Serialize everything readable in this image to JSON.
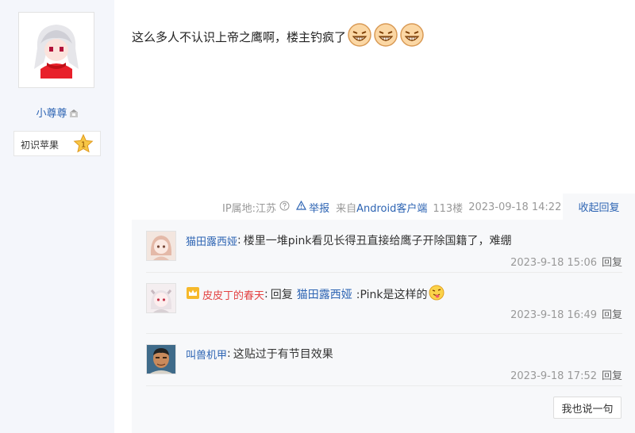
{
  "author": {
    "name": "小尊尊",
    "level_label": "初识苹果",
    "level_number": "1"
  },
  "post": {
    "text": "这么多人不认识上帝之鹰啊，楼主钓疯了"
  },
  "meta": {
    "ip_location": "IP属地:江苏",
    "report": "举报",
    "source_prefix": "来自",
    "source_app": "Android客户端",
    "floor": "113楼",
    "datetime": "2023-09-18 14:22",
    "collapse_reply": "收起回复"
  },
  "replies": [
    {
      "user": "猫田露西娅",
      "colon": ":",
      "text": "楼里一堆pink看见长得丑直接给鹰子开除国籍了，难绷",
      "time": "2023-9-18 15:06",
      "reply_label": "回复"
    },
    {
      "user": "皮皮丁的春天",
      "colon": ":",
      "reply_prefix": "回复",
      "reply_target": "猫田露西娅",
      "text": ":Pink是这样的",
      "time": "2023-9-18 16:49",
      "reply_label": "回复"
    },
    {
      "user": "叫兽机甲",
      "colon": ":",
      "text": "这贴过于有节目效果",
      "time": "2023-9-18 17:52",
      "reply_label": "回复"
    }
  ],
  "say_button": "我也说一句",
  "colors": {
    "link_blue": "#2d64b3",
    "vip_red": "#e34242",
    "meta_gray": "#999999",
    "sidebar_bg": "#f4f6fb",
    "reply_bg": "#f7f8fa"
  }
}
